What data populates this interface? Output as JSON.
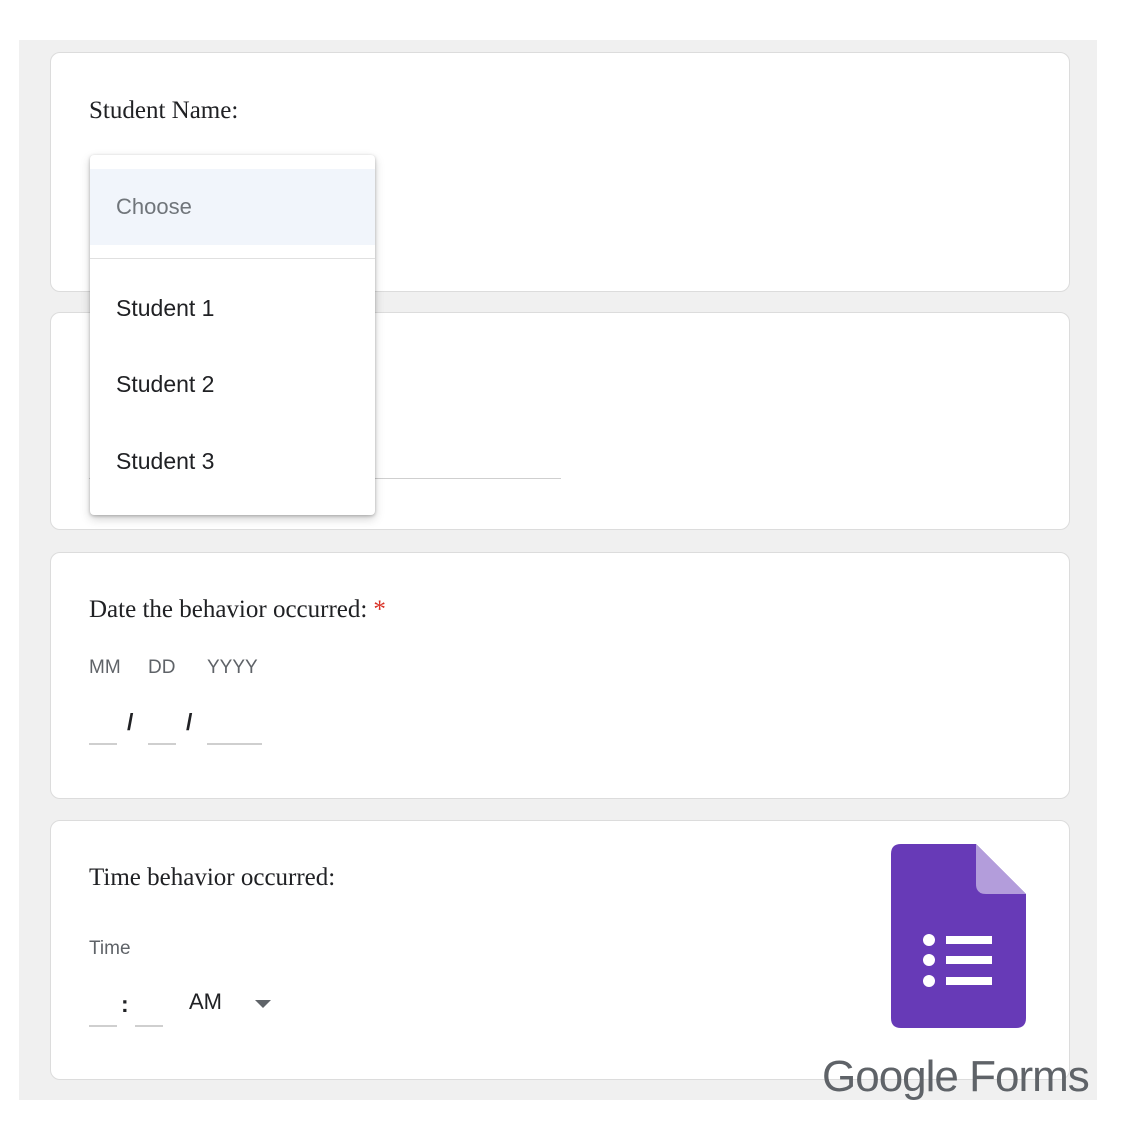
{
  "questions": {
    "student_name": {
      "title": "Student Name:",
      "dropdown": {
        "placeholder": "Choose",
        "options": [
          "Student 1",
          "Student 2",
          "Student 3"
        ]
      }
    },
    "date": {
      "title": "Date the behavior occurred:",
      "required_mark": "*",
      "labels": {
        "month": "MM",
        "day": "DD",
        "year": "YYYY"
      },
      "separator": "/"
    },
    "time": {
      "title": "Time behavior occurred:",
      "label": "Time",
      "separator": ":",
      "period": "AM"
    }
  },
  "branding": {
    "word_google": "Google",
    "word_forms": "Forms",
    "colors": {
      "icon_purple": "#673ab7",
      "icon_fold": "#b39ddb",
      "word": "#5f6368"
    },
    "icon": "google-forms-icon"
  }
}
